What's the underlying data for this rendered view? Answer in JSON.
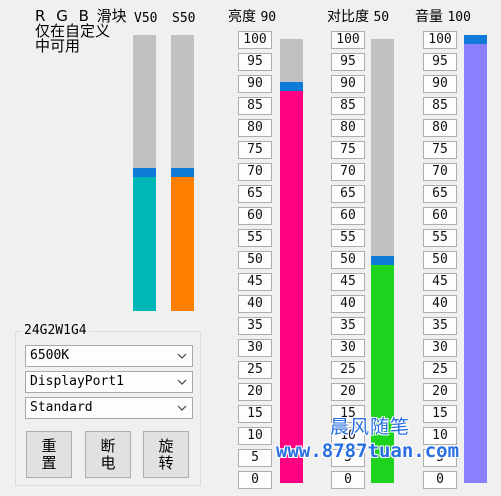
{
  "note": {
    "line1_prefix": "R G B",
    "line1_suffix": "滑块",
    "line2": "仅在自定义",
    "line3": "中可用"
  },
  "rgb": {
    "v_label": "V50",
    "s_label": "S50",
    "v_value": 50,
    "s_value": 50,
    "v_color": "#00b7b7",
    "s_color": "#ff8000"
  },
  "brightness": {
    "label": "亮度",
    "value_text": "90",
    "value": 90,
    "color": "#ff0080"
  },
  "contrast": {
    "label": "对比度",
    "value_text": "50",
    "value": 50,
    "color": "#1ed31e"
  },
  "volume": {
    "label": "音量",
    "value_text": "100",
    "value": 100,
    "color": "#8a80ff"
  },
  "thumb_color": "#0f7bd8",
  "steps": [
    "100",
    "95",
    "90",
    "85",
    "80",
    "75",
    "70",
    "65",
    "60",
    "55",
    "50",
    "45",
    "40",
    "35",
    "30",
    "25",
    "20",
    "15",
    "10",
    "5",
    "0"
  ],
  "monitor": {
    "model": "24G2W1G4",
    "color_temp": "6500K",
    "input": "DisplayPort1",
    "mode": "Standard",
    "reset_button": "重置",
    "power_off_button": "断电",
    "rotate_button": "旋转"
  },
  "watermark": {
    "title": "晨风随笔",
    "url": "www.8787tuan.com"
  }
}
